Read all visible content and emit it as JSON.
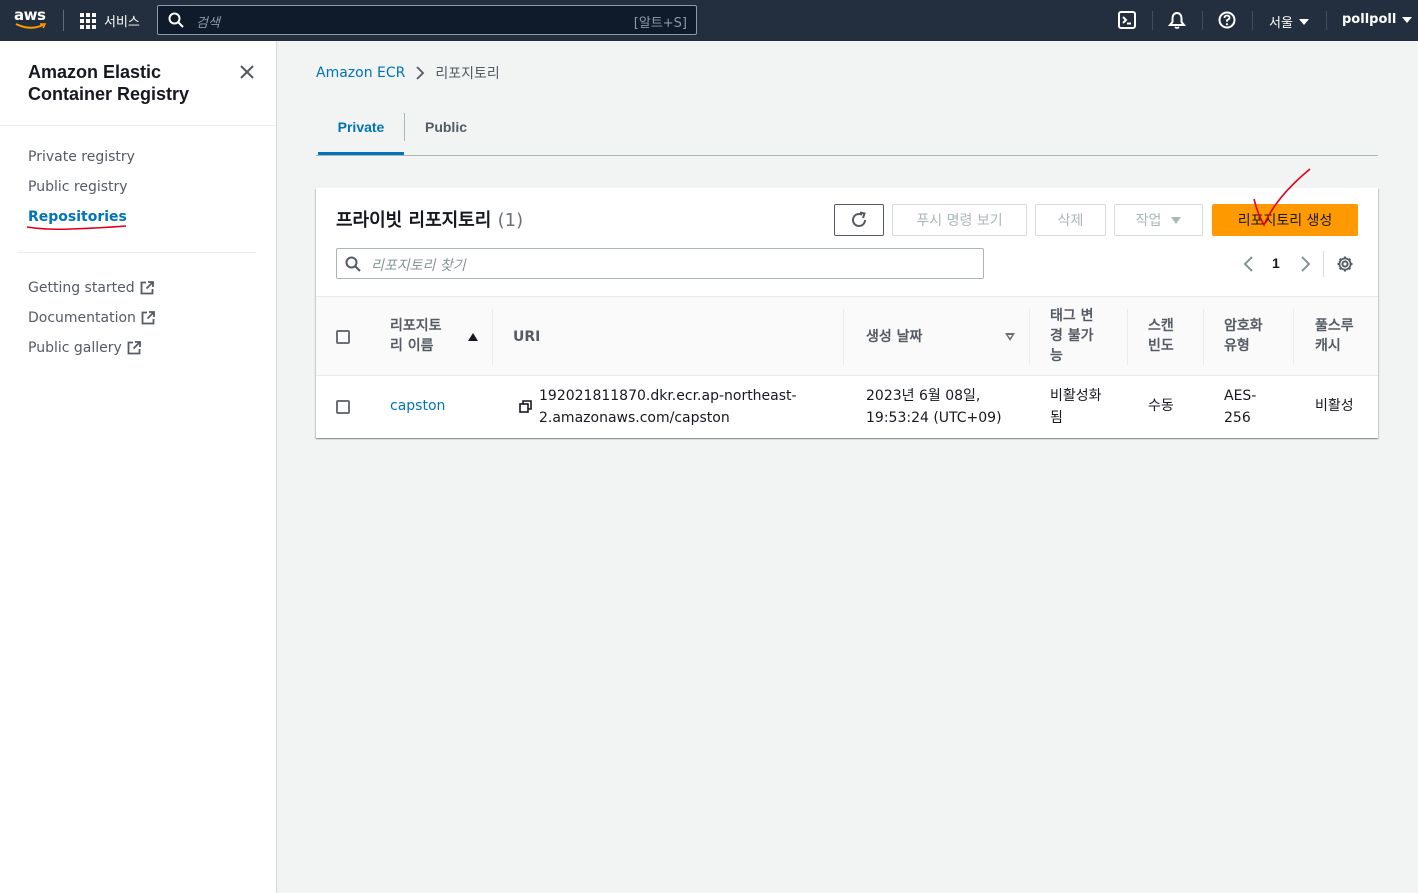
{
  "topnav": {
    "logo": "aws",
    "services_label": "서비스",
    "search_placeholder": "검색",
    "search_shortcut": "[알트+S]",
    "region": "서울",
    "user": "pollpoll",
    "icons": [
      "cloudshell-icon",
      "bell-icon",
      "help-icon"
    ]
  },
  "sidebar": {
    "title": "Amazon Elastic Container Registry",
    "items": [
      {
        "label": "Private registry"
      },
      {
        "label": "Public registry"
      },
      {
        "label": "Repositories",
        "active": true
      }
    ],
    "external_links": [
      {
        "label": "Getting started"
      },
      {
        "label": "Documentation"
      },
      {
        "label": "Public gallery"
      }
    ]
  },
  "breadcrumb": {
    "root": "Amazon ECR",
    "current": "리포지토리"
  },
  "tabs": [
    {
      "label": "Private",
      "active": true
    },
    {
      "label": "Public",
      "active": false
    }
  ],
  "panel": {
    "title": "프라이빗 리포지토리",
    "count": "(1)",
    "buttons": {
      "push_commands": "푸시 명령 보기",
      "delete": "삭제",
      "actions": "작업",
      "create": "리포지토리 생성"
    },
    "search_placeholder": "리포지토리 찾기",
    "page": "1"
  },
  "table": {
    "columns": {
      "name": "리포지토\n리 이름",
      "uri": "URI",
      "created": "생성 날짜",
      "tag_immutability": "태그 변\n경 불가\n능",
      "scan": "스캔\n빈도",
      "encryption": "암호화\n유형",
      "pull_through": "풀스루\n캐시"
    },
    "rows": [
      {
        "name": "capston",
        "uri": "192021811870.dkr.ecr.ap-northeast-\n2.amazonaws.com/capston",
        "created": "2023년 6월 08일,\n19:53:24 (UTC+09)",
        "tag_immutability": "비활성화\n됨",
        "scan": "수동",
        "encryption": "AES-\n256",
        "pull_through": "비활성"
      }
    ]
  },
  "colors": {
    "nav_bg": "#232f3e",
    "link": "#0073bb",
    "primary_button": "#ff9900",
    "annotation": "#e0001b"
  }
}
